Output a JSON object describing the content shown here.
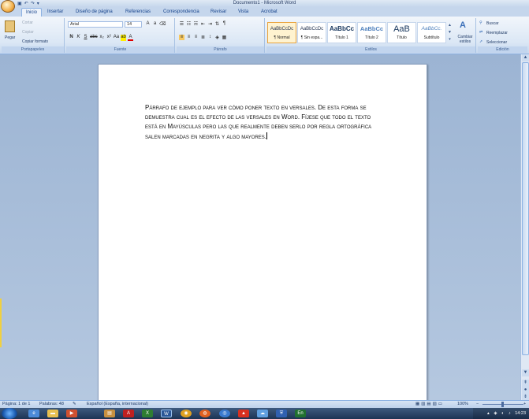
{
  "window": {
    "title": "Documento1 - Microsoft Word"
  },
  "tabs": [
    "Inicio",
    "Insertar",
    "Diseño de página",
    "Referencias",
    "Correspondencia",
    "Revisar",
    "Vista",
    "Acrobat"
  ],
  "ribbon": {
    "clipboard": {
      "paste": "Pegar",
      "cut": "Cortar",
      "copy": "Copiar",
      "format_painter": "Copiar formato",
      "label": "Portapapeles"
    },
    "font": {
      "name": "Arial",
      "size": "14",
      "label": "Fuente"
    },
    "paragraph": {
      "label": "Párrafo"
    },
    "styles": {
      "items": [
        {
          "sample": "AaBbCcDc",
          "name": "¶ Normal"
        },
        {
          "sample": "AaBbCcDc",
          "name": "¶ Sin espa..."
        },
        {
          "sample": "AaBbCc",
          "name": "Título 1"
        },
        {
          "sample": "AaBbCc",
          "name": "Título 2"
        },
        {
          "sample": "AaB",
          "name": "Título"
        },
        {
          "sample": "AaBbCc.",
          "name": "Subtítulo"
        }
      ],
      "change_styles": "Cambiar estilos",
      "label": "Estilos"
    },
    "editing": {
      "find": "Buscar",
      "replace": "Reemplazar",
      "select": "Seleccionar",
      "label": "Edición"
    }
  },
  "document": {
    "text": "Párrafo de ejemplo para ver cómo poner texto en versales. De esta forma se demuestra cual es el efecto de las versales en Word. Fíjese que todo el texto está en Mayúsculas pero las que realmente deben serlo por regla ortográfica salen marcadas en negrita y algo mayores."
  },
  "status": {
    "page": "Página: 1 de 1",
    "words": "Palabras: 48",
    "language": "Español (España, internacional)",
    "zoom": "100%"
  },
  "taskbar": {
    "clock": "14:23"
  }
}
